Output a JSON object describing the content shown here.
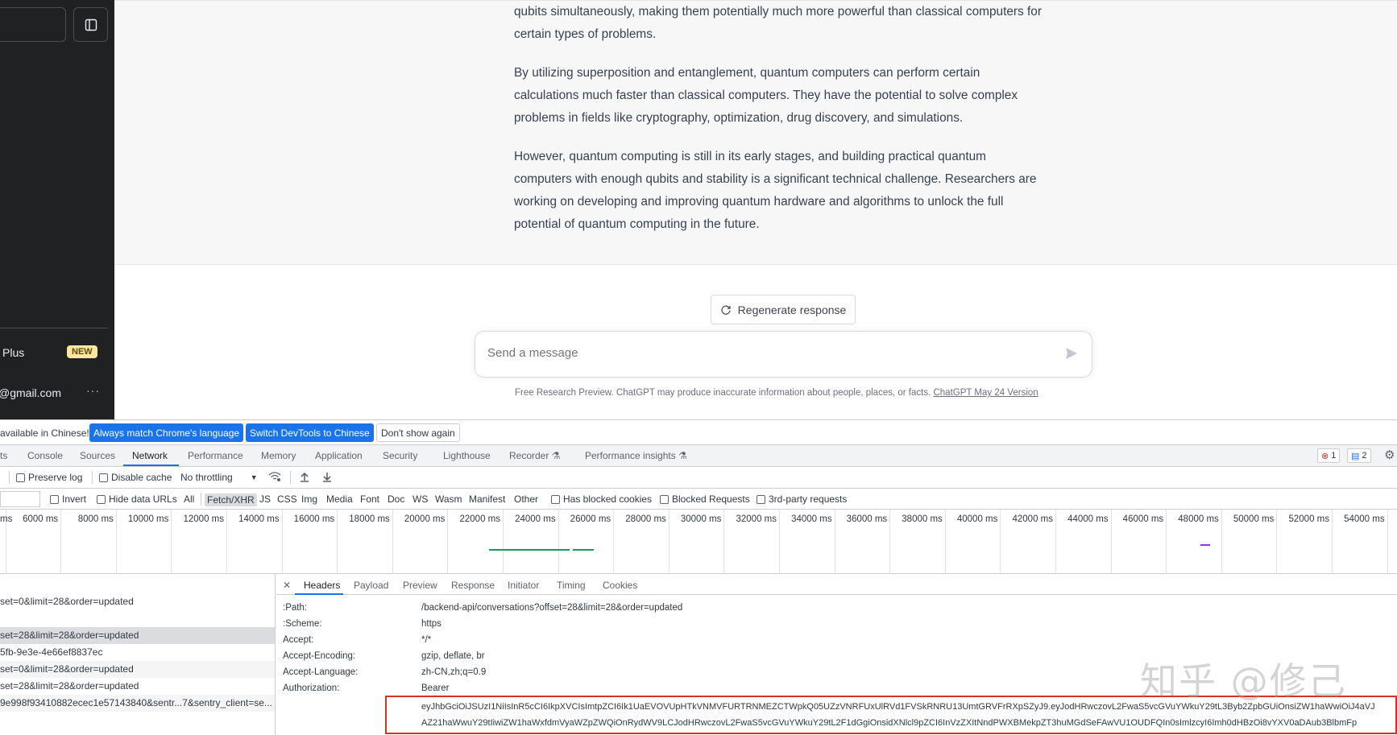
{
  "sidebar": {
    "plus_label": "Plus",
    "new_badge": "NEW",
    "email": "@gmail.com",
    "more": "···"
  },
  "response": {
    "p1": "qubits simultaneously, making them potentially much more powerful than classical computers for certain types of problems.",
    "p2": "By utilizing superposition and entanglement, quantum computers can perform certain calculations much faster than classical computers. They have the potential to solve complex problems in fields like cryptography, optimization, drug discovery, and simulations.",
    "p3": "However, quantum computing is still in its early stages, and building practical quantum computers with enough qubits and stability is a significant technical challenge. Researchers are working on developing and improving quantum hardware and algorithms to unlock the full potential of quantum computing in the future."
  },
  "composer": {
    "regenerate": "Regenerate response",
    "placeholder": "Send a message",
    "disclaimer": "Free Research Preview. ChatGPT may produce inaccurate information about people, places, or facts.",
    "version_link": "ChatGPT May 24 Version"
  },
  "devtools": {
    "infobar": {
      "text": "available in Chinese!",
      "btn_match": "Always match Chrome's language",
      "btn_switch": "Switch DevTools to Chinese",
      "btn_dont": "Don't show again"
    },
    "tabs": [
      "ts",
      "Console",
      "Sources",
      "Network",
      "Performance",
      "Memory",
      "Application",
      "Security",
      "Lighthouse",
      "Recorder",
      "Performance insights"
    ],
    "errors": "1",
    "messages": "2",
    "toolbar1": {
      "preserve_log": "Preserve log",
      "disable_cache": "Disable cache",
      "throttling": "No throttling"
    },
    "toolbar2": {
      "invert": "Invert",
      "hide_data_urls": "Hide data URLs",
      "types": [
        "All",
        "Fetch/XHR",
        "JS",
        "CSS",
        "Img",
        "Media",
        "Font",
        "Doc",
        "WS",
        "Wasm",
        "Manifest",
        "Other"
      ],
      "has_blocked": "Has blocked cookies",
      "blocked_requests": "Blocked Requests",
      "third_party": "3rd-party requests"
    },
    "timeline_labels": [
      "ms",
      "6000 ms",
      "8000 ms",
      "10000 ms",
      "12000 ms",
      "14000 ms",
      "16000 ms",
      "18000 ms",
      "20000 ms",
      "22000 ms",
      "24000 ms",
      "26000 ms",
      "28000 ms",
      "30000 ms",
      "32000 ms",
      "34000 ms",
      "36000 ms",
      "38000 ms",
      "40000 ms",
      "42000 ms",
      "44000 ms",
      "46000 ms",
      "48000 ms",
      "50000 ms",
      "52000 ms",
      "54000 ms"
    ],
    "requests": [
      "set=0&limit=28&order=updated",
      "",
      "set=28&limit=28&order=updated",
      "5fb-9e3e-4e66ef8837ec",
      "set=0&limit=28&order=updated",
      "set=28&limit=28&order=updated",
      "9e998f93410882ecec1e57143840&sentr...7&sentry_client=se..."
    ],
    "detail_tabs": [
      "Headers",
      "Payload",
      "Preview",
      "Response",
      "Initiator",
      "Timing",
      "Cookies"
    ],
    "headers": [
      {
        "name": ":Path:",
        "value": "/backend-api/conversations?offset=28&limit=28&order=updated"
      },
      {
        "name": ":Scheme:",
        "value": "https"
      },
      {
        "name": "Accept:",
        "value": "*/*"
      },
      {
        "name": "Accept-Encoding:",
        "value": "gzip, deflate, br"
      },
      {
        "name": "Accept-Language:",
        "value": "zh-CN,zh;q=0.9"
      },
      {
        "name": "Authorization:",
        "value": "Bearer"
      }
    ],
    "token_line1": "eyJhbGciOiJSUzI1NiIsInR5cCI6IkpXVCIsImtpZCI6Ik1UaEVOVUpHTkVNMVFURTRNMEZCTWpkQ05UZzVNRFUxUlRVd1FVSkRNRU13UmtGRVFrRXpSZyJ9.eyJodHRwczovL2FwaS5vcGVuYWkuY29tL3Byb2ZpbGUiOnsiZW1haWwiOiJ4aVJ",
    "token_line2": "AZ21haWwuY29tIiwiZW1haWxfdmVyaWZpZWQiOnRydWV9LCJodHRwczovL2FwaS5vcGVuYWkuY29tL2F1dGgiOnsidXNlcl9pZCI6InVzZXItNndPWXBMekpZT3huMGdSeFAwVU1OUDFQIn0sImlzcyI6Imh0dHBzOi8vYXV0aDAub3BlbmFp"
  },
  "watermark": "知乎 @修己"
}
